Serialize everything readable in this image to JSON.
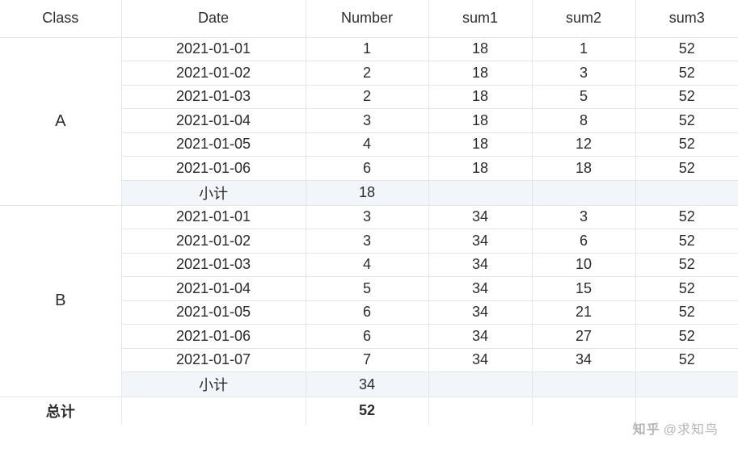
{
  "columns": [
    "Class",
    "Date",
    "Number",
    "sum1",
    "sum2",
    "sum3"
  ],
  "groups": [
    {
      "class": "A",
      "rows": [
        {
          "date": "2021-01-01",
          "number": 1,
          "sum1": 18,
          "sum2": 1,
          "sum3": 52
        },
        {
          "date": "2021-01-02",
          "number": 2,
          "sum1": 18,
          "sum2": 3,
          "sum3": 52
        },
        {
          "date": "2021-01-03",
          "number": 2,
          "sum1": 18,
          "sum2": 5,
          "sum3": 52
        },
        {
          "date": "2021-01-04",
          "number": 3,
          "sum1": 18,
          "sum2": 8,
          "sum3": 52
        },
        {
          "date": "2021-01-05",
          "number": 4,
          "sum1": 18,
          "sum2": 12,
          "sum3": 52
        },
        {
          "date": "2021-01-06",
          "number": 6,
          "sum1": 18,
          "sum2": 18,
          "sum3": 52
        }
      ],
      "subtotal": {
        "label": "小计",
        "number": 18
      }
    },
    {
      "class": "B",
      "rows": [
        {
          "date": "2021-01-01",
          "number": 3,
          "sum1": 34,
          "sum2": 3,
          "sum3": 52
        },
        {
          "date": "2021-01-02",
          "number": 3,
          "sum1": 34,
          "sum2": 6,
          "sum3": 52
        },
        {
          "date": "2021-01-03",
          "number": 4,
          "sum1": 34,
          "sum2": 10,
          "sum3": 52
        },
        {
          "date": "2021-01-04",
          "number": 5,
          "sum1": 34,
          "sum2": 15,
          "sum3": 52
        },
        {
          "date": "2021-01-05",
          "number": 6,
          "sum1": 34,
          "sum2": 21,
          "sum3": 52
        },
        {
          "date": "2021-01-06",
          "number": 6,
          "sum1": 34,
          "sum2": 27,
          "sum3": 52
        },
        {
          "date": "2021-01-07",
          "number": 7,
          "sum1": 34,
          "sum2": 34,
          "sum3": 52
        }
      ],
      "subtotal": {
        "label": "小计",
        "number": 34
      }
    }
  ],
  "grand_total": {
    "label": "总计",
    "number": 52
  },
  "watermark": {
    "brand": "知乎",
    "handle": "@求知鸟"
  }
}
